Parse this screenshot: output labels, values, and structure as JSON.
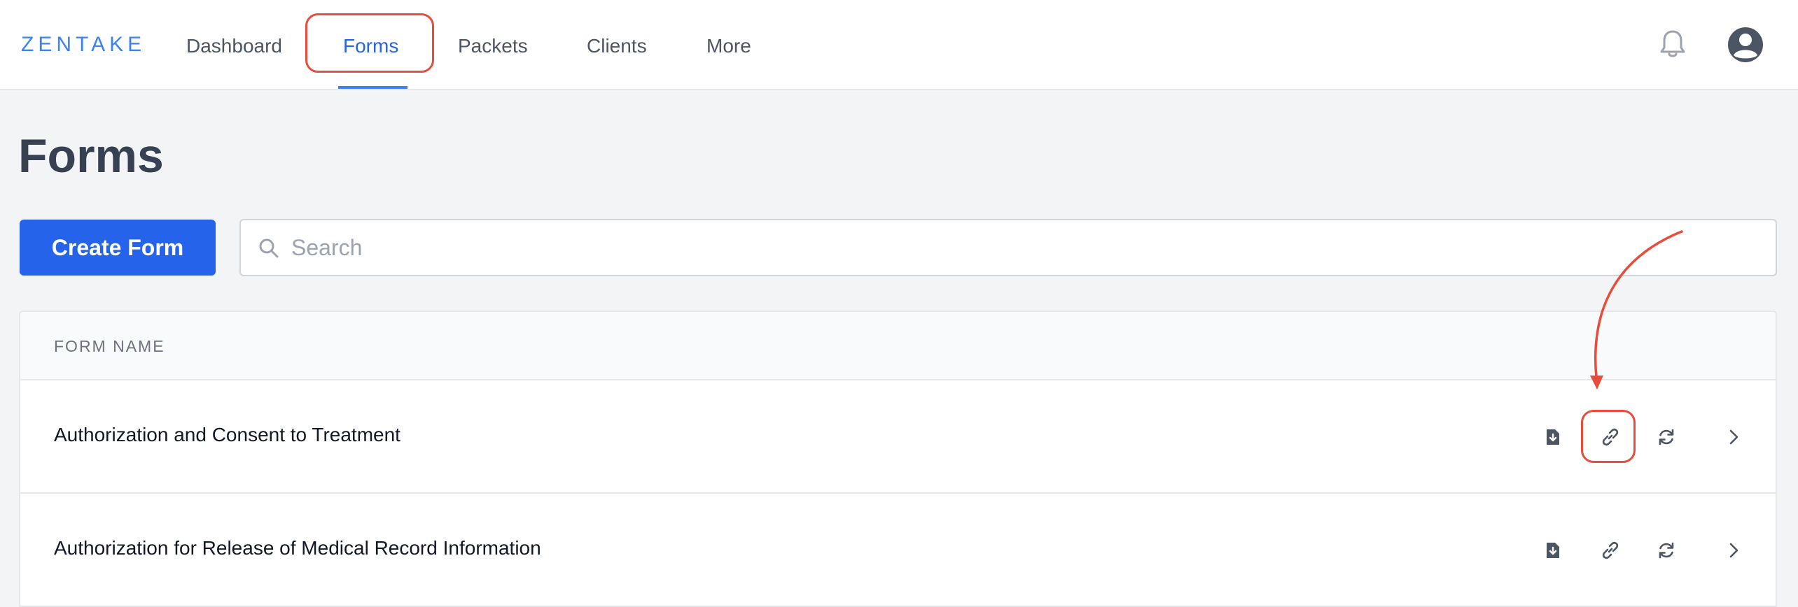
{
  "app": {
    "logo": "ZENTAKE"
  },
  "nav": {
    "items": [
      {
        "label": "Dashboard",
        "active": false
      },
      {
        "label": "Forms",
        "active": true
      },
      {
        "label": "Packets",
        "active": false
      },
      {
        "label": "Clients",
        "active": false
      },
      {
        "label": "More",
        "active": false
      }
    ],
    "notifications_icon": "bell-icon",
    "profile_icon": "user-circle-icon"
  },
  "page": {
    "title": "Forms"
  },
  "toolbar": {
    "create_label": "Create Form",
    "search": {
      "placeholder": "Search",
      "value": ""
    }
  },
  "table": {
    "column_header": "FORM NAME",
    "rows": [
      {
        "name": "Authorization and Consent to Treatment",
        "actions": [
          "download-icon",
          "link-icon",
          "refresh-icon",
          "chevron-right-icon"
        ]
      },
      {
        "name": "Authorization for Release of Medical Record Information",
        "actions": [
          "download-icon",
          "link-icon",
          "refresh-icon",
          "chevron-right-icon"
        ]
      }
    ]
  },
  "colors": {
    "brand": "#3b82f6",
    "primary_button": "#2563eb",
    "annotation": "#e74c3c"
  }
}
